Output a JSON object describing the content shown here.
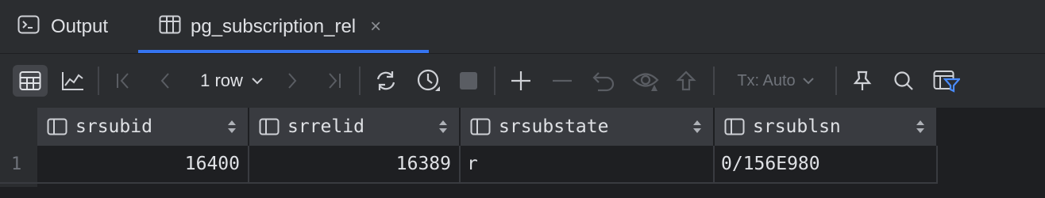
{
  "tabs": [
    {
      "label": "Output",
      "icon": "console-icon"
    },
    {
      "label": "pg_subscription_rel",
      "icon": "table-icon",
      "close": "×",
      "active": true
    }
  ],
  "toolbar": {
    "row_count": "1 row",
    "tx_mode": "Tx: Auto"
  },
  "grid": {
    "columns": [
      {
        "name": "srsubid"
      },
      {
        "name": "srrelid"
      },
      {
        "name": "srsubstate"
      },
      {
        "name": "srsublsn"
      }
    ],
    "rows": [
      {
        "num": "1",
        "cells": [
          "16400",
          "16389",
          "r",
          "0/156E980"
        ]
      }
    ]
  },
  "colors": {
    "accent": "#3574f0",
    "filter": "#4a8cff",
    "background": "#1e1f22",
    "panel": "#2b2d30",
    "header": "#393b40"
  }
}
